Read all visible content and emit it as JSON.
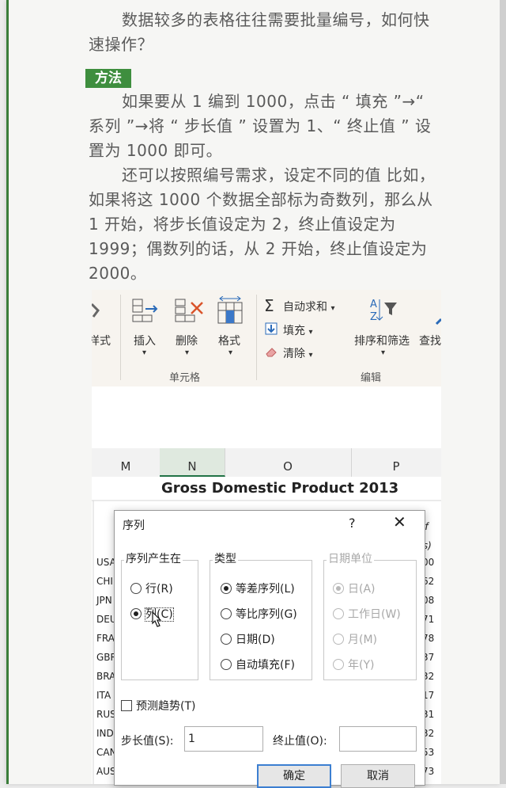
{
  "book": {
    "para1": "数据较多的表格往往需要批量编号，如何快速操作？",
    "tag": "方法",
    "para2": "如果要从 1 编到 1000，点击 “ 填充 ”→“ 系列 ”→将 “ 步长值 ” 设置为 1、“ 终止值 ” 设置为 1000 即可。",
    "para3": "还可以按照编号需求，设定不同的值 比如，如果将这 1000 个数据全部标为奇数列，那么从 1 开始，将步长值设定为 2，终止值设定为 1999；偶数列的话，从 2 开始，终止值设定为 2000。"
  },
  "ribbon": {
    "partial_format": "样式",
    "insert": "插入",
    "delete": "删除",
    "format": "格式",
    "cells_group": "单元格",
    "autosum": "自动求和",
    "fill": "填充",
    "clear": "清除",
    "sort_filter": "排序和筛选",
    "find": "查找",
    "edit_group": "编辑"
  },
  "sheet": {
    "columns": [
      "M",
      "N",
      "O",
      "P"
    ],
    "title": "Gross Domestic Product 2013",
    "right_frag1": "of",
    "right_frag2": "rs)",
    "rows": [
      {
        "code": "USA",
        "val": "00"
      },
      {
        "code": "CHI",
        "val": "62"
      },
      {
        "code": "JPN",
        "val": "08"
      },
      {
        "code": "DEU",
        "val": "71"
      },
      {
        "code": "FRA",
        "val": "78"
      },
      {
        "code": "GBR",
        "val": "37"
      },
      {
        "code": "BRA",
        "val": "32"
      },
      {
        "code": "ITA",
        "val": "17"
      },
      {
        "code": "RUS",
        "val": "31"
      },
      {
        "code": "IND",
        "val": "32"
      },
      {
        "code": "CAN",
        "val": "53"
      },
      {
        "code": "AUS",
        "val": "73"
      }
    ]
  },
  "dialog": {
    "title": "序列",
    "help": "?",
    "close": "✕",
    "series_in": "序列产生在",
    "rows_opt": "行(R)",
    "cols_opt": "列(C)",
    "type_label": "类型",
    "linear": "等差序列(L)",
    "growth": "等比序列(G)",
    "date": "日期(D)",
    "autofill": "自动填充(F)",
    "date_unit": "日期单位",
    "day": "日(A)",
    "weekday": "工作日(W)",
    "month": "月(M)",
    "year": "年(Y)",
    "trend": "预测趋势(T)",
    "step_label": "步长值(S):",
    "step_value": "1",
    "stop_label": "终止值(O):",
    "stop_value": "",
    "ok": "确定",
    "cancel": "取消"
  }
}
